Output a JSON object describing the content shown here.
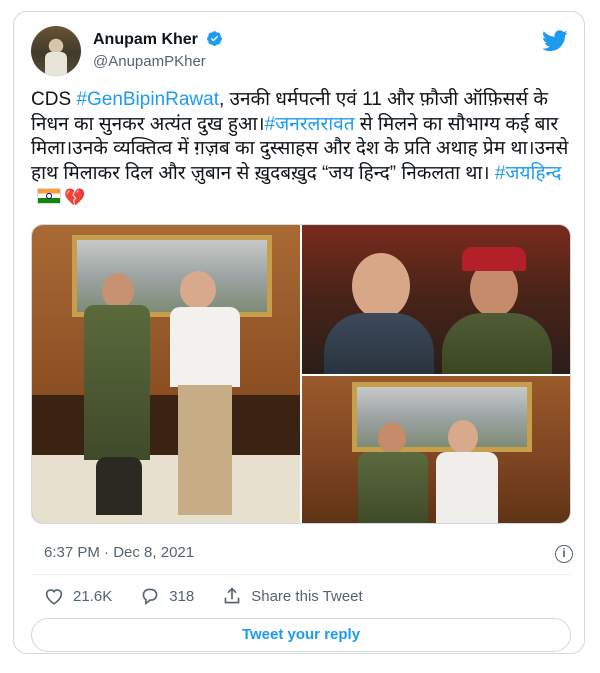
{
  "author": {
    "name": "Anupam Kher",
    "handle": "@AnupamPKher"
  },
  "tweet": {
    "line1_pre": "CDS ",
    "line1_tag": "#GenBipinRawat",
    "line1_post": ", उनकी धर्मपत्नी एवं 11 और फ़ौजी ऑफ़िसर्स के निधन का सुनकर अत्यंत दुख हुआ।",
    "line2_tag": "#जनरलरावत",
    "line2_post": " से मिलने का सौभाग्य कई बार मिला।उनके व्यक्तित्व में ग़ज़ब का दुस्साहस और देश के प्रति अथाह प्रेम था।उनसे हाथ मिलाकर दिल और ज़ुबान से ख़ुदबख़ुद “जय हिन्द” निकलता था। ",
    "line3_tag": "#जयहिन्द",
    "emoji_heart": "💔"
  },
  "meta": {
    "time": "6:37 PM",
    "separator": " · ",
    "date": "Dec 8, 2021"
  },
  "actions": {
    "likes": "21.6K",
    "replies": "318",
    "share_label": "Share this Tweet"
  },
  "reply_button": "Tweet your reply",
  "icons": [
    "verified-icon",
    "twitter-bird-icon",
    "info-icon",
    "heart-icon",
    "reply-icon",
    "share-icon"
  ],
  "colors": {
    "link": "#1d9bf0",
    "text": "#0f1419",
    "muted": "#536471",
    "border": "#cfd9de"
  }
}
